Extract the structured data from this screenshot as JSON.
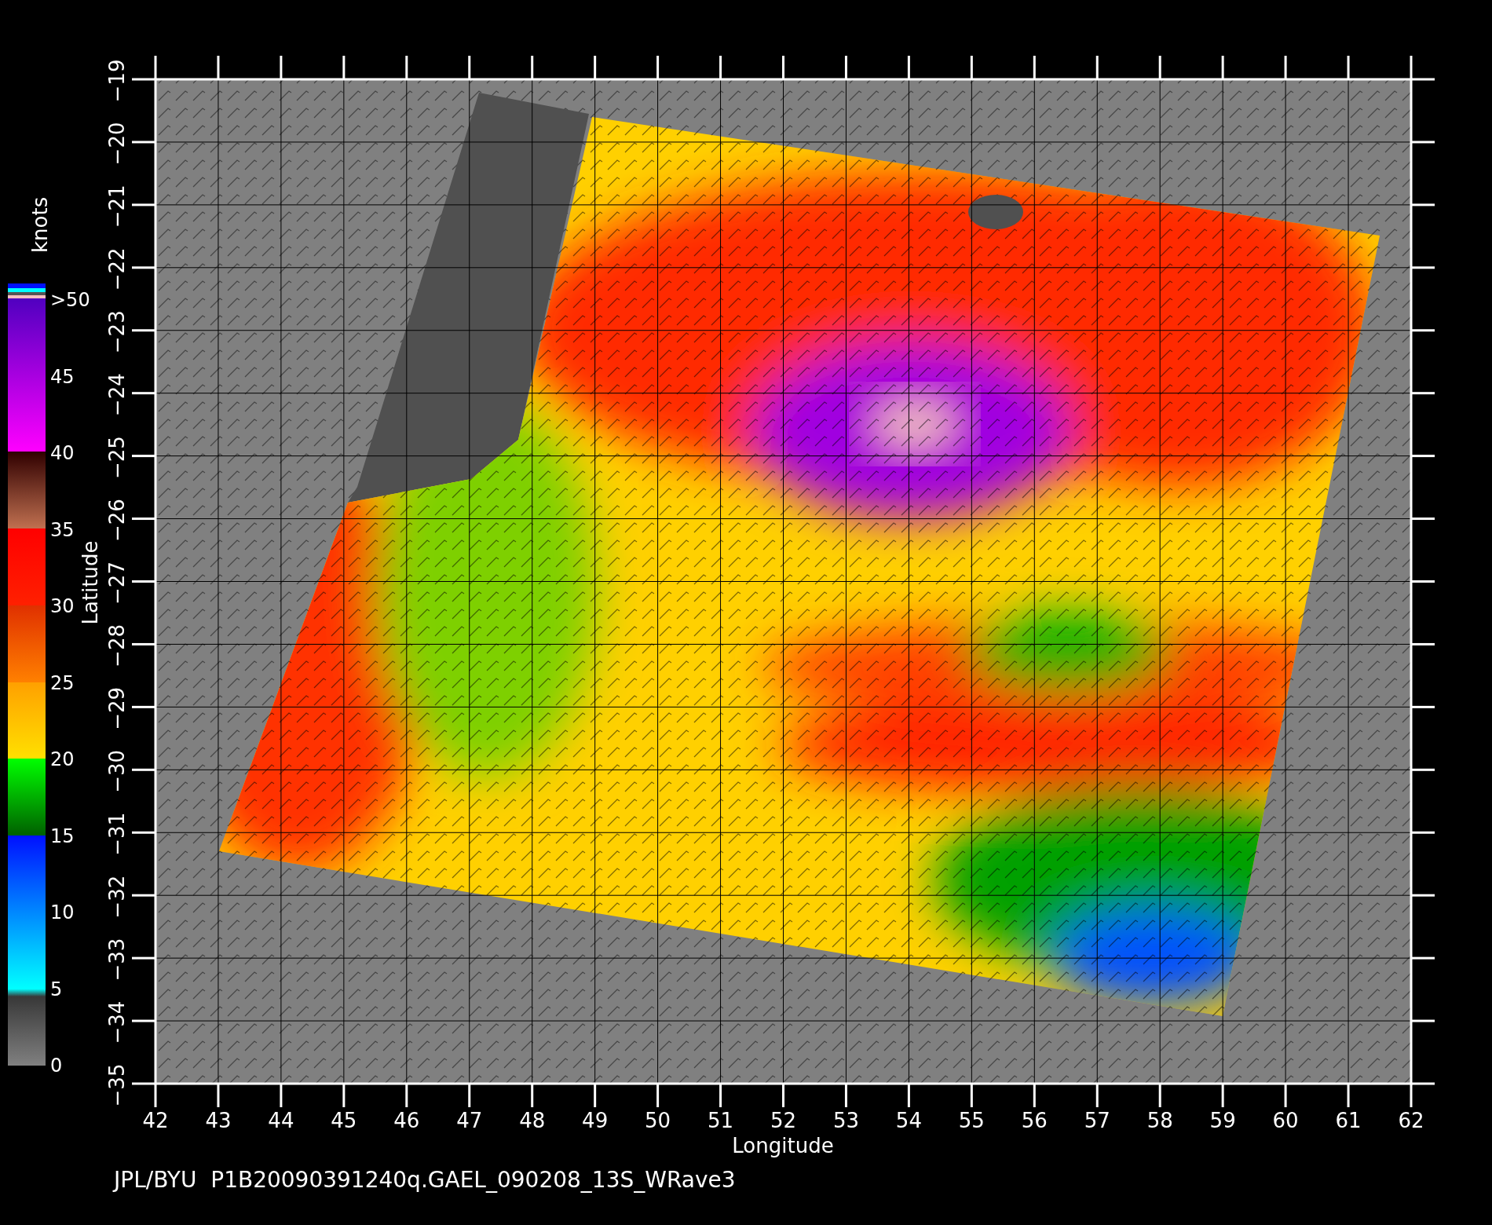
{
  "colorbar": {
    "unit": "knots",
    "labels": [
      ">50",
      "45",
      "40",
      "35",
      "30",
      "25",
      "20",
      "15",
      "10",
      "5",
      "0"
    ]
  },
  "map": {
    "xlabel": "Longitude",
    "ylabel": "Latitude",
    "xticks": [
      "42",
      "43",
      "44",
      "45",
      "46",
      "47",
      "48",
      "49",
      "50",
      "51",
      "52",
      "53",
      "54",
      "55",
      "56",
      "57",
      "58",
      "59",
      "60",
      "61",
      "62"
    ],
    "yticks": [
      "−19",
      "−20",
      "−21",
      "−22",
      "−23",
      "−24",
      "−25",
      "−26",
      "−27",
      "−28",
      "−29",
      "−30",
      "−31",
      "−32",
      "−33",
      "−34",
      "−35"
    ]
  },
  "caption": "JPL/BYU  P1B20090391240q.GAEL_090208_13S_WRave3"
}
